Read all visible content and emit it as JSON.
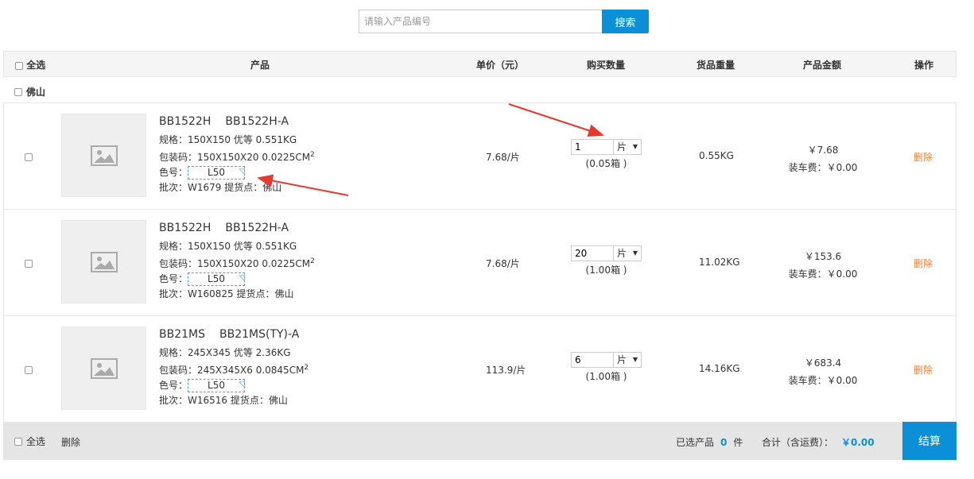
{
  "search": {
    "placeholder": "请输入产品编号",
    "button": "搜索"
  },
  "header": {
    "select_all": "全选",
    "product": "产品",
    "unit_price": "单价（元）",
    "quantity": "购买数量",
    "weight": "货品重量",
    "amount": "产品金额",
    "action": "操作"
  },
  "group": {
    "name": "佛山"
  },
  "items": [
    {
      "code": "BB1522H",
      "model": "BB1522H-A",
      "spec": "规格：150X150  优等  0.551KG",
      "pack": "包装码：150X150X20  0.0225CM",
      "color_label": "色号：",
      "color": "L50",
      "batch": "批次：W1679  提货点：佛山",
      "price": "7.68/片",
      "qty": "1",
      "unit": "片",
      "boxes": "(0.05箱 )",
      "weight": "0.55KG",
      "amount": "￥7.68",
      "shipping": "装车费：￥0.00",
      "delete": "删除"
    },
    {
      "code": "BB1522H",
      "model": "BB1522H-A",
      "spec": "规格：150X150  优等  0.551KG",
      "pack": "包装码：150X150X20  0.0225CM",
      "color_label": "色号：",
      "color": "L50",
      "batch": "批次：W160825  提货点：佛山",
      "price": "7.68/片",
      "qty": "20",
      "unit": "片",
      "boxes": "(1.00箱 )",
      "weight": "11.02KG",
      "amount": "￥153.6",
      "shipping": "装车费：￥0.00",
      "delete": "删除"
    },
    {
      "code": "BB21MS",
      "model": "BB21MS(TY)-A",
      "spec": "规格：245X345  优等  2.36KG",
      "pack": "包装码：245X345X6  0.0845CM",
      "color_label": "色号：",
      "color": "L50",
      "batch": "批次：W16516  提货点：佛山",
      "price": "113.9/片",
      "qty": "6",
      "unit": "片",
      "boxes": "(1.00箱 )",
      "weight": "14.16KG",
      "amount": "￥683.4",
      "shipping": "装车费：￥0.00",
      "delete": "删除"
    }
  ],
  "footer": {
    "select_all": "全选",
    "delete": "删除",
    "selected_prefix": "已选产品",
    "selected_count": "0",
    "selected_suffix": "件",
    "total_label": "合计（含运费）：",
    "total": "￥0.00",
    "checkout": "结算"
  },
  "colors": {
    "accent": "#0b8fd6",
    "delete": "#f0803c",
    "arrow": "#e8372f"
  }
}
